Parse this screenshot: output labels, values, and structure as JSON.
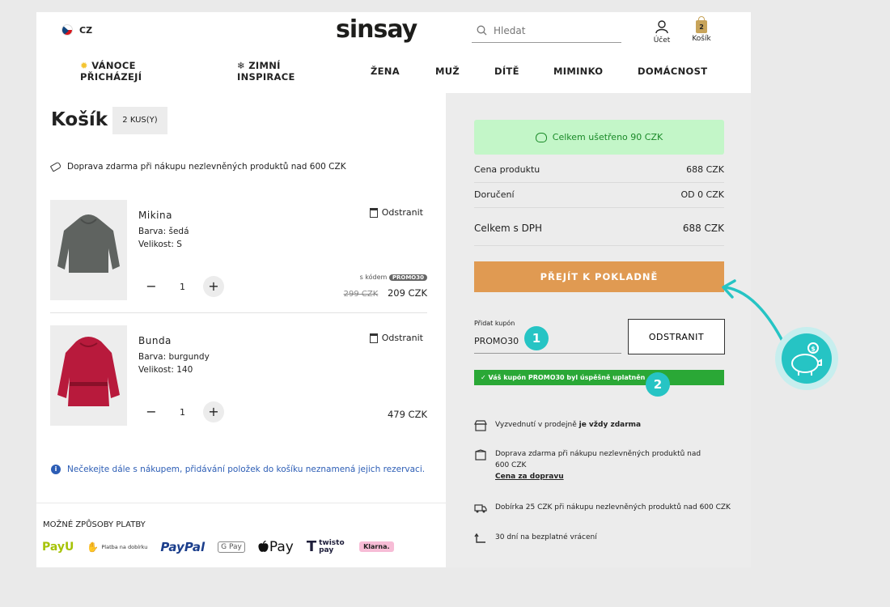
{
  "header": {
    "country": "CZ",
    "logo": "sinsay",
    "search_placeholder": "Hledat",
    "account_label": "Účet",
    "cart_label": "Košík",
    "cart_count": "2",
    "nav": [
      "VÁNOCE PŘICHÁZEJÍ",
      "ZIMNÍ INSPIRACE",
      "ŽENA",
      "MUŽ",
      "DÍTĚ",
      "MIMINKO",
      "DOMÁCNOST"
    ]
  },
  "cart": {
    "title": "Košík",
    "count": "2 KUS(Y)",
    "shipping_note": "Doprava zdarma při nákupu nezlevněných produktů nad 600 CZK",
    "items": [
      {
        "name": "Mikina",
        "color": "Barva: šedá",
        "size": "Velikost: S",
        "qty": "1",
        "remove": "Odstranit",
        "promo_prefix": "s kódem",
        "promo_code": "PROMO30",
        "old_price": "299 CZK",
        "price": "209 CZK",
        "image_color": "#5f6360"
      },
      {
        "name": "Bunda",
        "color": "Barva: burgundy",
        "size": "Velikost: 140",
        "qty": "1",
        "remove": "Odstranit",
        "price": "479 CZK",
        "image_color": "#b81a3c"
      }
    ],
    "info": "Nečekejte dále s nákupem, přidávání položek do košíku neznamená jejich rezervaci."
  },
  "payment": {
    "title": "MOŽNÉ ZPŮSOBY PLATBY",
    "methods": [
      "PayU",
      "Platba na dobírku",
      "PayPal",
      "G Pay",
      "Pay",
      "twisto pay",
      "Klarna."
    ]
  },
  "summary": {
    "saved": "Celkem ušetřeno 90 CZK",
    "product_label": "Cena produktu",
    "product_value": "688 CZK",
    "delivery_label": "Doručení",
    "delivery_value": "OD 0 CZK",
    "total_label": "Celkem s DPH",
    "total_value": "688 CZK",
    "checkout": "PŘEJÍT K POKLADNĚ",
    "coupon_label": "Přidat kupón",
    "coupon_value": "PROMO30",
    "coupon_remove": "ODSTRANIT",
    "coupon_success": "✓ Váš kupón PROMO30 byl úspěšně uplatněn",
    "feat1_text": "Vyzvednutí v prodejně ",
    "feat1_bold": "je vždy zdarma",
    "feat2_text": "Doprava zdarma při nákupu nezlevněných produktů nad 600 CZK",
    "feat2_link": "Cena za dopravu",
    "feat3_text": "Dobírka 25 CZK při nákupu nezlevněných produktů nad 600 CZK",
    "feat4_text": "30 dní na bezplatné vrácení"
  },
  "annotations": {
    "badge1": "1",
    "badge2": "2"
  },
  "colors": {
    "accent": "#e09a52",
    "success": "#2aa836",
    "saved_bg": "#c3f6c8",
    "annotation": "#26c4c4",
    "info": "#2c5db5"
  }
}
